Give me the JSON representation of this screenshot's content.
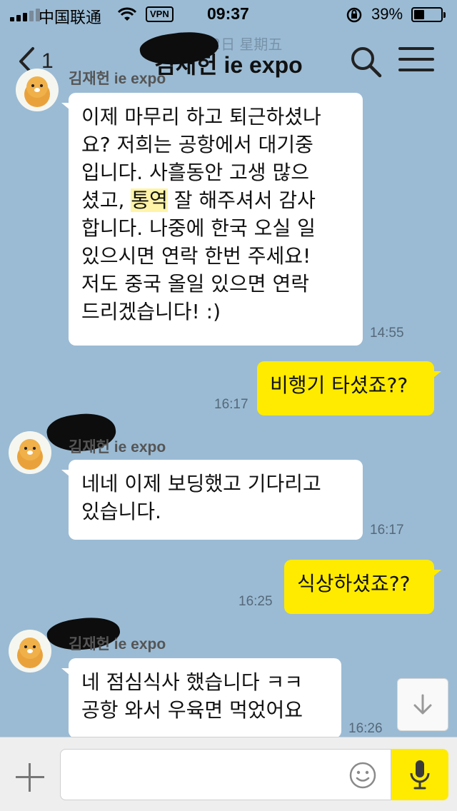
{
  "status_bar": {
    "carrier": "中国联通",
    "vpn": "VPN",
    "time": "09:37",
    "battery": "39%",
    "battery_level": 0.39
  },
  "header": {
    "date_overlay": "2  月22日 星期五",
    "back_count": "1",
    "title": "김재헌 ie expo"
  },
  "messages": [
    {
      "dir": "in",
      "sender": "김재헌 ie expo",
      "lines": [
        "이제 마무리 하고 퇴근하셨나",
        "요? 저희는 공항에서 대기중",
        "입니다. 사흘동안 고생 많으",
        "셨고, ",
        "통역",
        " 잘 해주셔서 감사",
        "합니다. 나중에 한국 오실 일",
        "있으시면 연락 한번 주세요!",
        "저도 중국 올일 있으면 연락",
        "드리겠습니다! :)"
      ],
      "time": "14:55"
    },
    {
      "dir": "out",
      "text": "비행기 타셨죠??",
      "time": "16:17"
    },
    {
      "dir": "in",
      "sender": "김재헌 ie expo",
      "lines": [
        "네네 이제 보딩했고 기다리고",
        "있습니다."
      ],
      "time": "16:17"
    },
    {
      "dir": "out",
      "text": "식상하셨죠??",
      "time": "16:25"
    },
    {
      "dir": "in",
      "sender": "김재헌 ie expo",
      "lines": [
        "네 점심식사 했습니다 ㅋㅋ",
        "공항 와서 우육면 먹었어요"
      ],
      "time": "16:26"
    }
  ],
  "input": {
    "value": "",
    "placeholder": ""
  },
  "colors": {
    "background": "#9bbbd4",
    "outgoing": "#ffeb00",
    "incoming": "#ffffff",
    "highlight": "#fff4a8"
  },
  "icons": [
    "back-chevron-icon",
    "search-icon",
    "menu-icon",
    "arrow-down-icon",
    "plus-icon",
    "emoji-icon",
    "microphone-icon",
    "avatar-lion-icon"
  ]
}
